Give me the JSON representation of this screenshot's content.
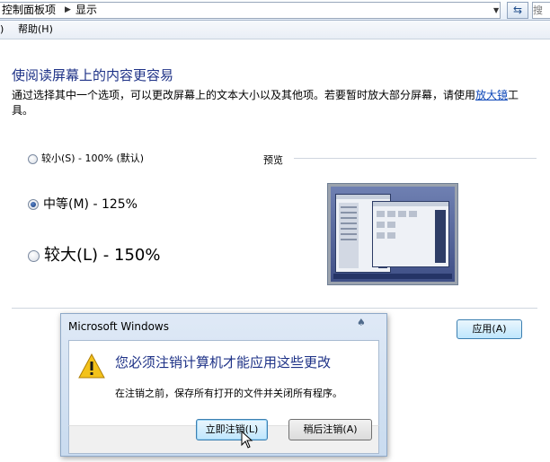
{
  "address_bar": {
    "crumbs": [
      "控制面板项",
      "显示"
    ],
    "search_placeholder": "搜"
  },
  "menu": {
    "paren": ")",
    "help": "帮助(H)"
  },
  "content": {
    "heading": "使阅读屏幕上的内容更容易",
    "description_before": "通过选择其中一个选项，可以更改屏幕上的文本大小以及其他项。若要暂时放大部分屏幕，请使用",
    "description_link": "放大镜",
    "description_after": "工具。",
    "options": [
      {
        "label": "较小(S) - 100% (默认)",
        "selected": false
      },
      {
        "label": "中等(M) - 125%",
        "selected": true
      },
      {
        "label": "较大(L) - 150%",
        "selected": false
      }
    ],
    "preview_label": "预览",
    "apply_label": "应用(A)"
  },
  "dialog": {
    "title": "Microsoft Windows",
    "main_text": "您必须注销计算机才能应用这些更改",
    "sub_text": "在注销之前，保存所有打开的文件并关闭所有程序。",
    "buttons": {
      "logoff_now": "立即注销(L)",
      "logoff_later": "稍后注销(A)"
    }
  },
  "colors": {
    "heading": "#1e3287",
    "link": "#0b46b8",
    "warning_yellow": "#f3c21b"
  }
}
